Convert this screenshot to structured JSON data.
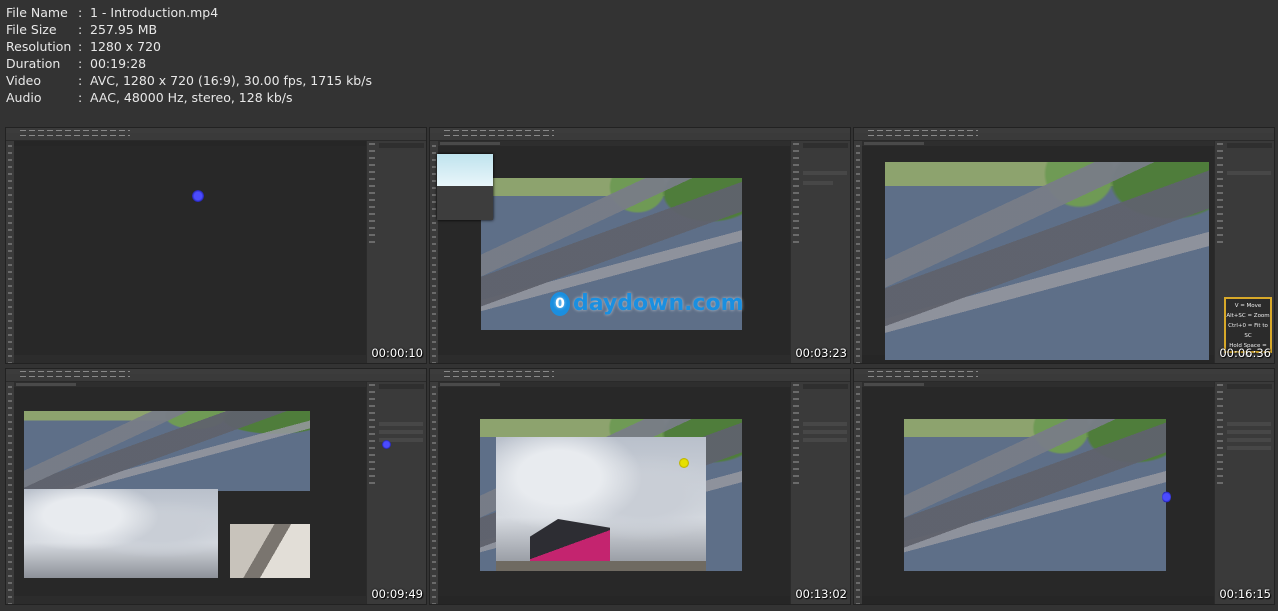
{
  "file_info": [
    {
      "key": "File Name",
      "value": "1 - Introduction.mp4"
    },
    {
      "key": "File Size",
      "value": "257.95 MB"
    },
    {
      "key": "Resolution",
      "value": "1280 x 720"
    },
    {
      "key": "Duration",
      "value": "00:19:28"
    },
    {
      "key": "Video",
      "value": "AVC, 1280 x 720 (16:9), 30.00 fps, 1715 kb/s"
    },
    {
      "key": "Audio",
      "value": "AAC, 48000 Hz, stereo, 128 kb/s"
    }
  ],
  "separator": ":",
  "thumbnails": [
    {
      "timecode": "00:00:10"
    },
    {
      "timecode": "00:03:23",
      "watermark_letter": "0",
      "watermark_text": "daydown.com"
    },
    {
      "timecode": "00:06:36",
      "shortcuts": [
        "V = Move",
        "Alt+SC = Zoom",
        "Ctrl+0 = Fit to SC",
        "Hold Space = Pan"
      ]
    },
    {
      "timecode": "00:09:49"
    },
    {
      "timecode": "00:13:02"
    },
    {
      "timecode": "00:16:15"
    }
  ],
  "colors": {
    "background": "#333333",
    "cursor": "#4b4bff",
    "shortcut_border": "#d7a829",
    "watermark": "#1a8fe0"
  }
}
